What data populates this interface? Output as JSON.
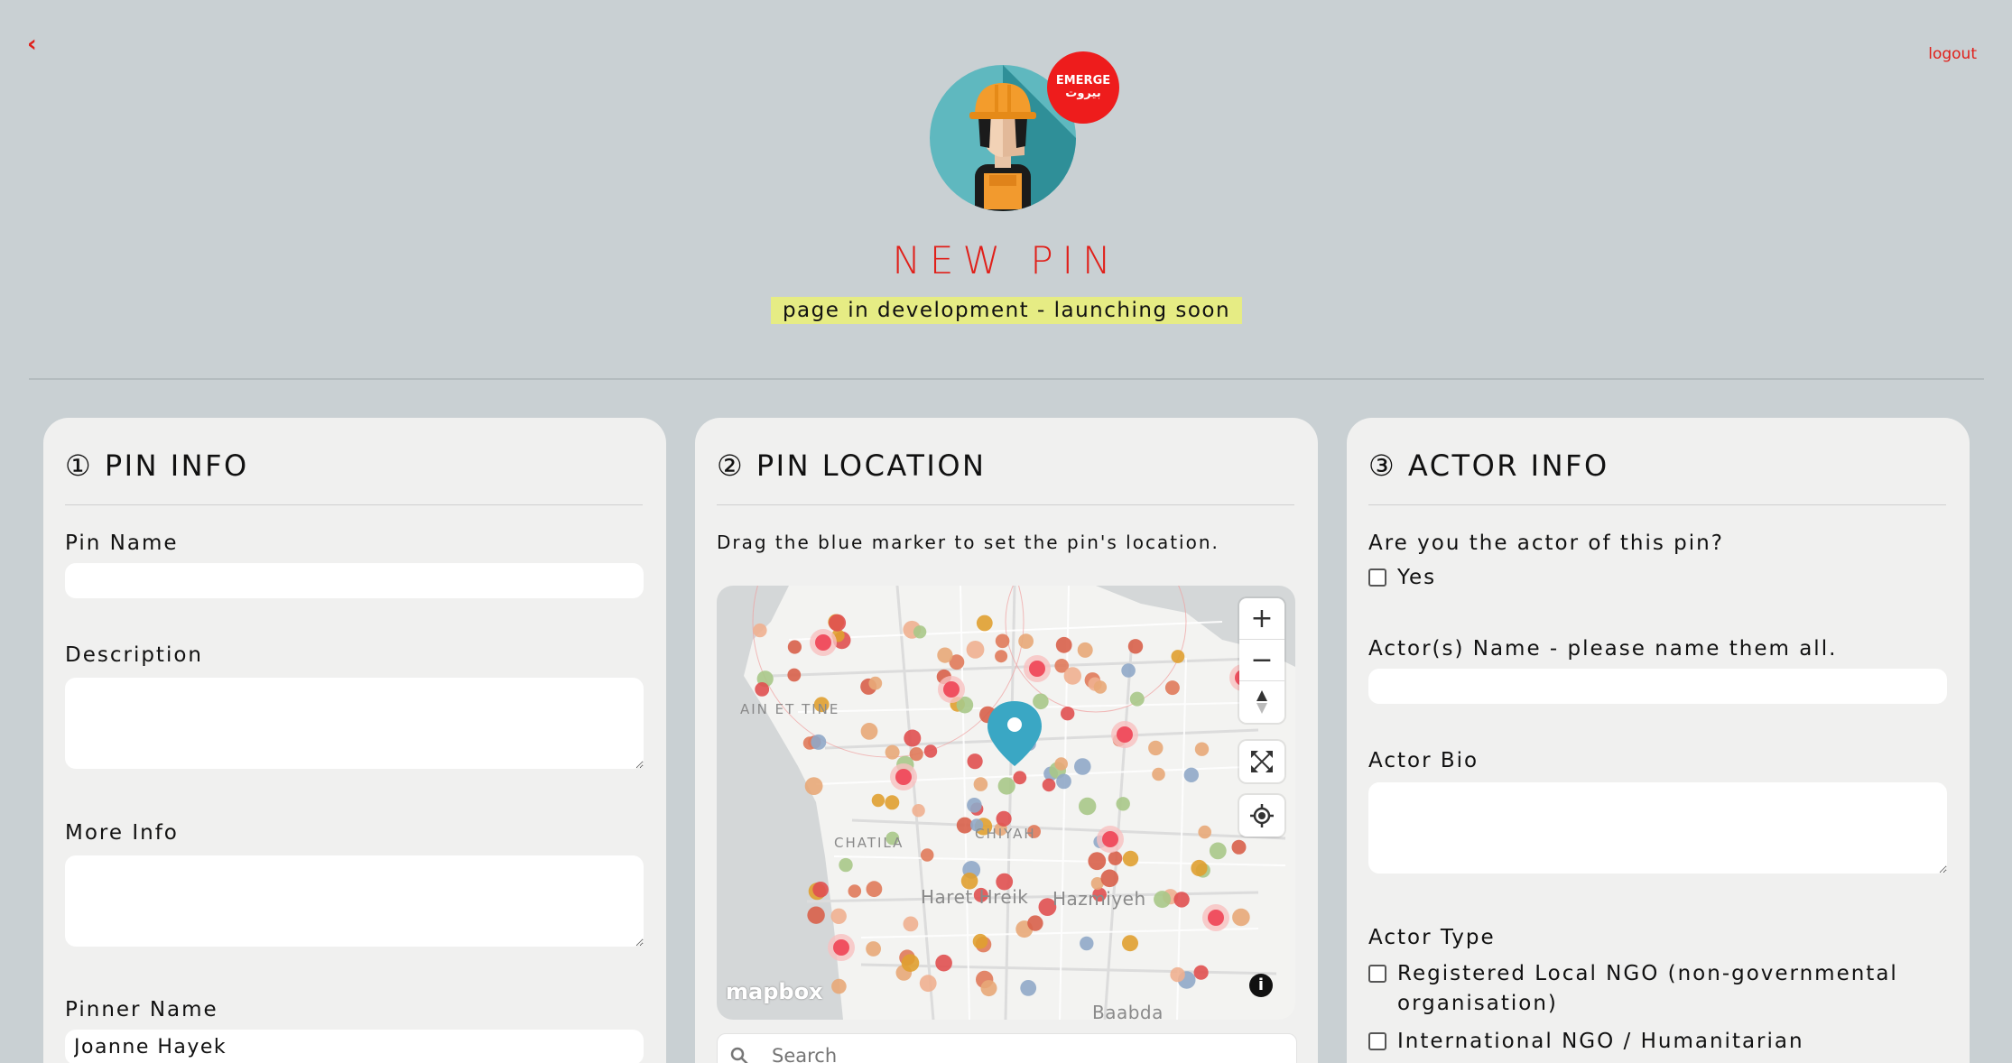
{
  "nav": {
    "back_symbol": "‹",
    "logout_label": "logout"
  },
  "brand": {
    "badge_line1": "EMERGE",
    "badge_line2": "بيروت"
  },
  "page": {
    "title": "NEW PIN",
    "dev_note": "page in development - launching soon"
  },
  "pin_info": {
    "title": "① PIN INFO",
    "pin_name_label": "Pin Name",
    "pin_name_value": "",
    "description_label": "Description",
    "more_info_label": "More Info",
    "pinner_name_label": "Pinner Name",
    "pinner_name_value": "Joanne Hayek"
  },
  "pin_location": {
    "title": "② PIN LOCATION",
    "help": "Drag the blue marker to set the pin's location.",
    "map_labels": [
      "AIN ET TINE",
      "CHATILA",
      "CHIYAH",
      "Haret Hreik",
      "Hazmiyeh",
      "Baabda"
    ],
    "attribution": "mapbox",
    "search_placeholder": "Search",
    "marker_color": "#3aa7c4"
  },
  "actor_info": {
    "title": "③ ACTOR INFO",
    "is_actor_label": "Are you the actor of this pin?",
    "yes_label": "Yes",
    "actor_names_label": "Actor(s) Name - please name them all.",
    "actor_bio_label": "Actor Bio",
    "actor_type_label": "Actor Type",
    "actor_types": [
      "Registered Local NGO (non-governmental organisation)",
      "International NGO / Humanitarian"
    ]
  },
  "colors": {
    "accent": "#e0201a",
    "background": "#c9d0d3",
    "card": "#f0f0ef",
    "highlight": "#e6ec84"
  }
}
